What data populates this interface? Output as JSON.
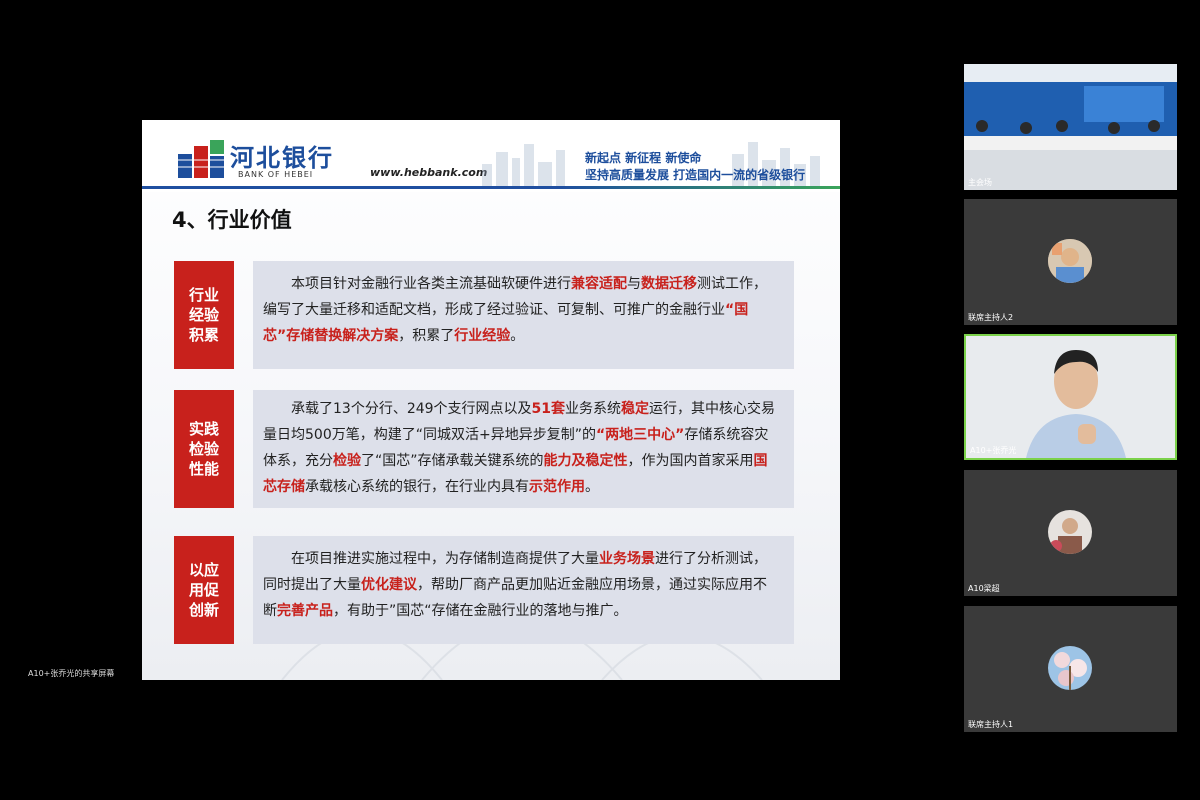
{
  "share": {
    "label": "A10+张乔光的共享屏幕"
  },
  "slide": {
    "bank_name": "河北银行",
    "bank_name_en": "BANK OF HEBEI",
    "url": "www.hebbank.com",
    "slogan_line1": "新起点  新征程  新使命",
    "slogan_line2": "坚持高质量发展  打造国内一流的省级银行",
    "title": "4、行业价值",
    "rows": [
      {
        "tag": "行业经验积累",
        "p1": "本项目针对金融行业各类主流基础软硬件进行",
        "h1": "兼容适配",
        "p2": "与",
        "h2": "数据迁移",
        "p3": "测试工作，编写了大量迁移和适配文档，形成了经过验证、可复制、可推广的金融行业",
        "h3": "“国芯”存储替换解决方案",
        "p4": "，积累了",
        "h4": "行业经验",
        "p5": "。"
      },
      {
        "tag": "实践检验性能",
        "p1": "承载了13个分行、249个支行网点以及",
        "h1": "51套",
        "p2": "业务系统",
        "h2": "稳定",
        "p3": "运行，其中核心交易量日均500万笔，构建了“同城双活+异地异步复制”的",
        "h3": "“两地三中心”",
        "p4": "存储系统容灾体系，充分",
        "h4": "检验",
        "p5": "了“国芯”存储承载关键系统的",
        "h5": "能力及稳定性",
        "p6": "，作为国内首家采用",
        "h6": "国芯存储",
        "p7": "承载核心系统的银行，在行业内具有",
        "h7": "示范作用",
        "p8": "。"
      },
      {
        "tag": "以应用促创新",
        "p1": "在项目推进实施过程中，为存储制造商提供了大量",
        "h1": "业务场景",
        "p2": "进行了分析测试，同时提出了大量",
        "h2": "优化建议",
        "p3": "，帮助厂商产品更加贴近金融应用场景，通过实际应用不断",
        "h3": "完善产品",
        "p4": "，有助于”国芯“存储在金融行业的落地与推广。"
      }
    ]
  },
  "participants": [
    {
      "name": "主会场"
    },
    {
      "name": "联席主持人2"
    },
    {
      "name": "A10+张乔光"
    },
    {
      "name": "A10梁超"
    },
    {
      "name": "联席主持人1"
    }
  ],
  "colors": {
    "accent_red": "#c8211c",
    "brand_blue": "#1d4e9c",
    "active_speaker": "#7bd14a"
  }
}
